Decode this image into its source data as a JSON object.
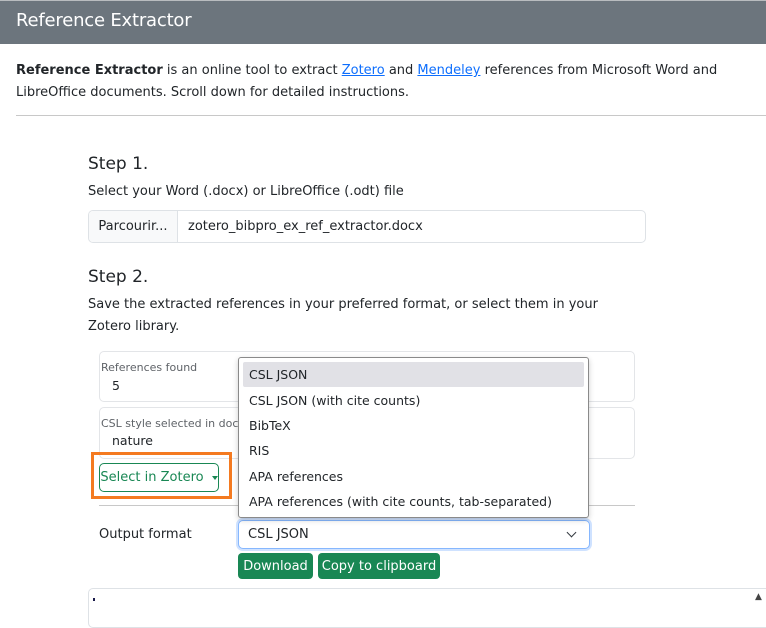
{
  "navbar": {
    "title": "Reference Extractor"
  },
  "intro": {
    "brand": "Reference Extractor",
    "text_1": " is an online tool to extract ",
    "link_zotero": "Zotero",
    "text_2": " and ",
    "link_mendeley": "Mendeley",
    "text_3": " references from Microsoft Word and LibreOffice documents. Scroll down for detailed instructions."
  },
  "step1": {
    "title": "Step 1.",
    "description": "Select your Word (.docx) or LibreOffice (.odt) file",
    "browse_label": "Parcourir...",
    "file_name": "zotero_bibpro_ex_ref_extractor.docx"
  },
  "step2": {
    "title": "Step 2.",
    "description": "Save the extracted references in your preferred format, or select them in your Zotero library.",
    "references_found_label": "References found",
    "references_found_value": "5",
    "csl_style_label": "CSL style selected in document",
    "csl_style_value": "nature",
    "select_in_zotero_label": "Select in Zotero",
    "output_format_label": "Output format",
    "output_format_selected": "CSL JSON",
    "output_format_options": [
      "CSL JSON",
      "CSL JSON (with cite counts)",
      "BibTeX",
      "RIS",
      "APA references",
      "APA references (with cite counts, tab-separated)"
    ],
    "download_label": "Download",
    "copy_label": "Copy to clipboard"
  },
  "colors": {
    "navbar_bg": "#6c757d",
    "link": "#0d6efd",
    "success": "#198754",
    "highlight": "#f47a20"
  }
}
